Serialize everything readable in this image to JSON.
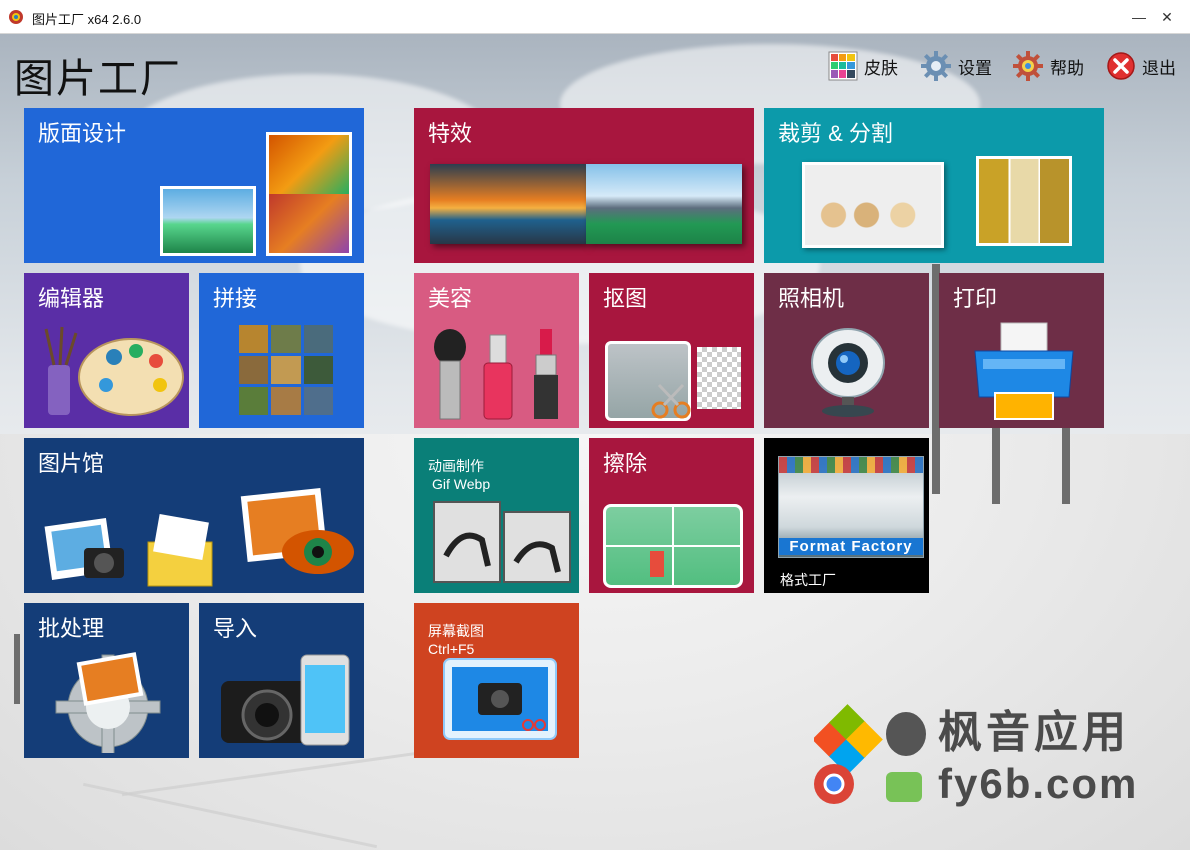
{
  "window": {
    "title": "图片工厂 x64 2.6.0",
    "min_glyph": "—",
    "close_glyph": "✕"
  },
  "app_title": "图片工厂",
  "toolbar": {
    "skin": "皮肤",
    "settings": "设置",
    "help": "帮助",
    "exit": "退出"
  },
  "tiles": {
    "layout": "版面设计",
    "effects": "特效",
    "crop": "裁剪 & 分割",
    "editor": "编辑器",
    "stitch": "拼接",
    "beauty": "美容",
    "cutout": "抠图",
    "camera": "照相机",
    "print": "打印",
    "gallery": "图片馆",
    "animation": "动画制作",
    "animation_sub": "Gif Webp",
    "erase": "擦除",
    "format_factory_logo": "Format Factory",
    "format_factory": "格式工厂",
    "batch": "批处理",
    "import": "导入",
    "screenshot": "屏幕截图",
    "screenshot_sub": "Ctrl+F5"
  },
  "watermark": {
    "line1": "枫音应用",
    "line2": "fy6b.com"
  },
  "colors": {
    "blue": "#2067d8",
    "crimson": "#a8163e",
    "teal": "#0c9aaa",
    "purple": "#5a2ea6",
    "pink": "#d85b82",
    "maroon": "#6e2e47",
    "navy": "#143d78",
    "green_teal": "#0a7f78",
    "orange": "#cf4320",
    "black": "#000000"
  }
}
